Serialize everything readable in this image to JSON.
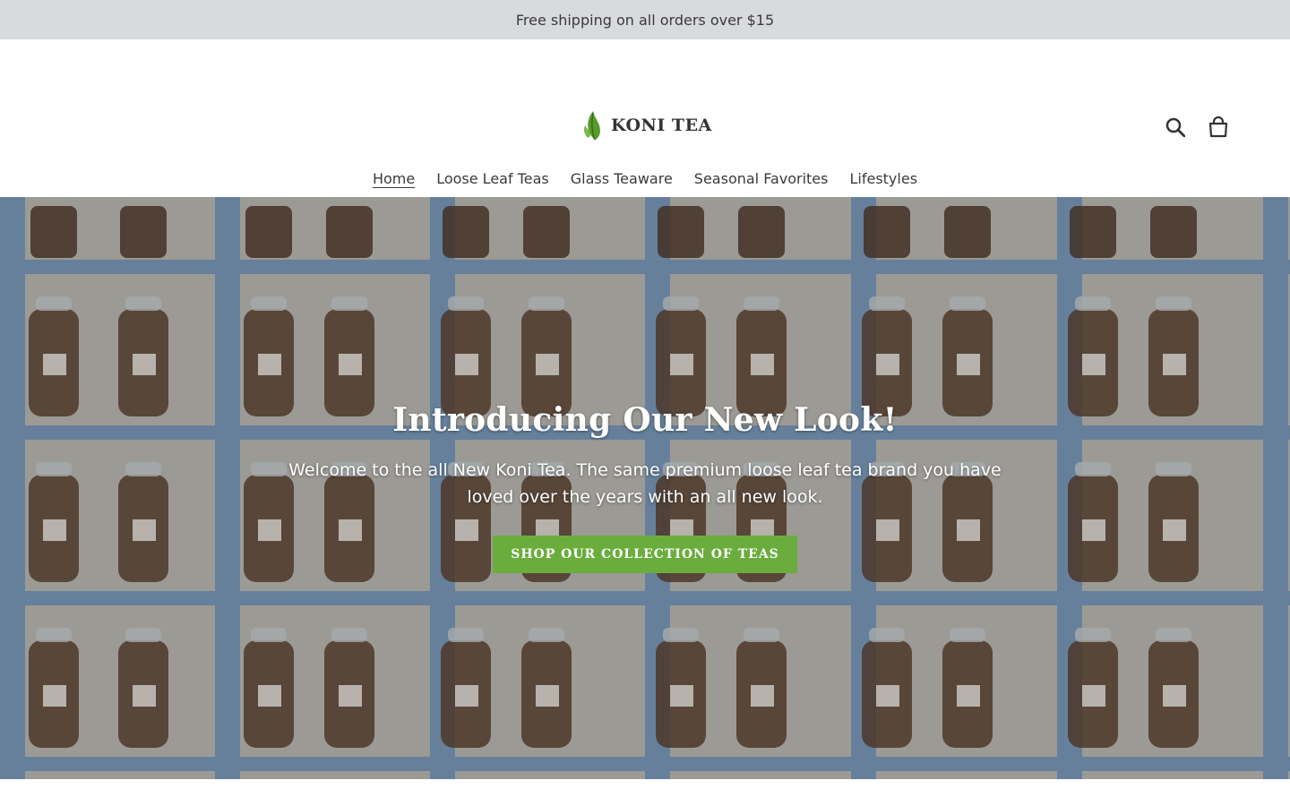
{
  "announcement": {
    "text": "Free shipping on all orders over $15"
  },
  "header": {
    "logo_text": "KONI TEA",
    "search_icon": "search-icon",
    "cart_icon": "cart-icon"
  },
  "nav": {
    "items": [
      {
        "label": "Home",
        "active": true
      },
      {
        "label": "Loose Leaf Teas"
      },
      {
        "label": "Glass Teaware"
      },
      {
        "label": "Seasonal Favorites"
      },
      {
        "label": "Lifestyles"
      }
    ]
  },
  "hero": {
    "title": "Introducing Our New Look!",
    "text": "Welcome to the all New Koni Tea. The same premium loose leaf tea brand you have loved over the years with an all new look.",
    "button_label": "SHOP OUR COLLECTION OF TEAS"
  },
  "colors": {
    "announcement_bg": "#d9dadd",
    "button_bg": "#6aad3d",
    "shelf_blue": "#7ea3c8"
  }
}
